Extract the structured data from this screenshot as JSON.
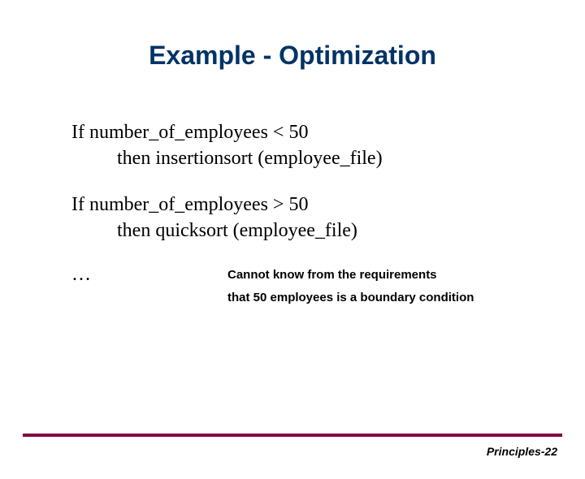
{
  "slide": {
    "title": "Example - Optimization",
    "block1": {
      "line1": "If number_of_employees < 50",
      "line2": "then insertionsort (employee_file)"
    },
    "block2": {
      "line1": "If number_of_employees > 50",
      "line2": "then quicksort (employee_file)"
    },
    "ellipsis": "…",
    "note": {
      "line1": "Cannot know from the requirements",
      "line2": "that 50 employees is a boundary condition"
    },
    "footer": "Principles-22"
  }
}
